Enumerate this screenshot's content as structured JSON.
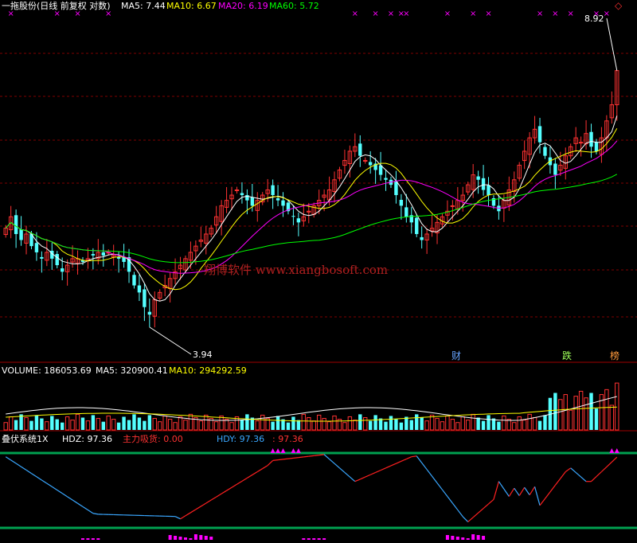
{
  "header": {
    "title": "一拖股份(日线 前复权 对数)",
    "ma5": "MA5: 7.44",
    "ma10": "MA10: 6.67",
    "ma20": "MA20: 6.19",
    "ma60": "MA60: 5.72"
  },
  "colors": {
    "up": "#ff3232",
    "down": "#54ffff",
    "ma5": "#ffffff",
    "ma10": "#ffff00",
    "ma20": "#ff00ff",
    "ma60": "#00ff00",
    "grid": "#800000",
    "osc_band": "#00a050",
    "hdz_up": "#ff2020",
    "hdz_down": "#3aa7ff",
    "fill": "#ff00ff",
    "watermark": "#b02020"
  },
  "price_panel": {
    "high_label": "8.92",
    "low_label": "3.94",
    "watermark": "翔博软件 www.xiangbosoft.com",
    "markers": [
      {
        "text": "财",
        "color": "#66a3ff"
      },
      {
        "text": "跌",
        "color": "#9eff5a"
      },
      {
        "text": "榜",
        "color": "#ff9a3c"
      }
    ],
    "top_marks": "×"
  },
  "volume_panel": {
    "volume": "VOLUME: 186053.69",
    "ma5": "MA5: 320900.41",
    "ma10": "MA10: 294292.59"
  },
  "indicator_panel": {
    "name": "叠伏系统1X",
    "hdz": "HDZ: 97.36",
    "zhuli": "主力吸货: 0.00",
    "hdy": "HDY: 97.36",
    "extra": ": 97.36"
  },
  "chart_data": {
    "type": "candlestick",
    "count": 120,
    "close": [
      5.4,
      5.6,
      5.3,
      5.2,
      5.3,
      5.1,
      5.0,
      4.9,
      5.0,
      4.9,
      4.8,
      4.7,
      4.8,
      4.9,
      4.9,
      4.85,
      4.9,
      4.95,
      5.0,
      4.95,
      5.0,
      4.95,
      4.9,
      4.85,
      4.7,
      4.5,
      4.4,
      4.2,
      4.1,
      4.3,
      4.4,
      4.5,
      4.6,
      4.7,
      4.8,
      4.9,
      5.0,
      5.1,
      5.2,
      5.3,
      5.4,
      5.6,
      5.8,
      5.9,
      6.0,
      6.1,
      6.0,
      5.9,
      5.8,
      5.9,
      6.0,
      6.1,
      6.0,
      5.9,
      5.8,
      5.7,
      5.6,
      5.5,
      5.6,
      5.7,
      5.8,
      5.9,
      6.0,
      6.1,
      6.3,
      6.5,
      6.7,
      6.9,
      7.0,
      6.8,
      6.7,
      6.6,
      6.5,
      6.4,
      6.3,
      6.2,
      6.0,
      5.8,
      5.6,
      5.5,
      5.3,
      5.2,
      5.3,
      5.4,
      5.5,
      5.6,
      5.7,
      5.8,
      5.9,
      6.0,
      6.2,
      6.4,
      6.3,
      6.1,
      6.0,
      5.8,
      5.7,
      5.9,
      6.1,
      6.3,
      6.6,
      6.9,
      7.2,
      7.4,
      7.1,
      6.8,
      6.6,
      6.4,
      6.6,
      6.8,
      7.0,
      7.2,
      7.1,
      7.3,
      7.0,
      6.9,
      7.2,
      7.6,
      8.0,
      8.92
    ],
    "low_value": 3.94,
    "high_value": 8.92
  }
}
